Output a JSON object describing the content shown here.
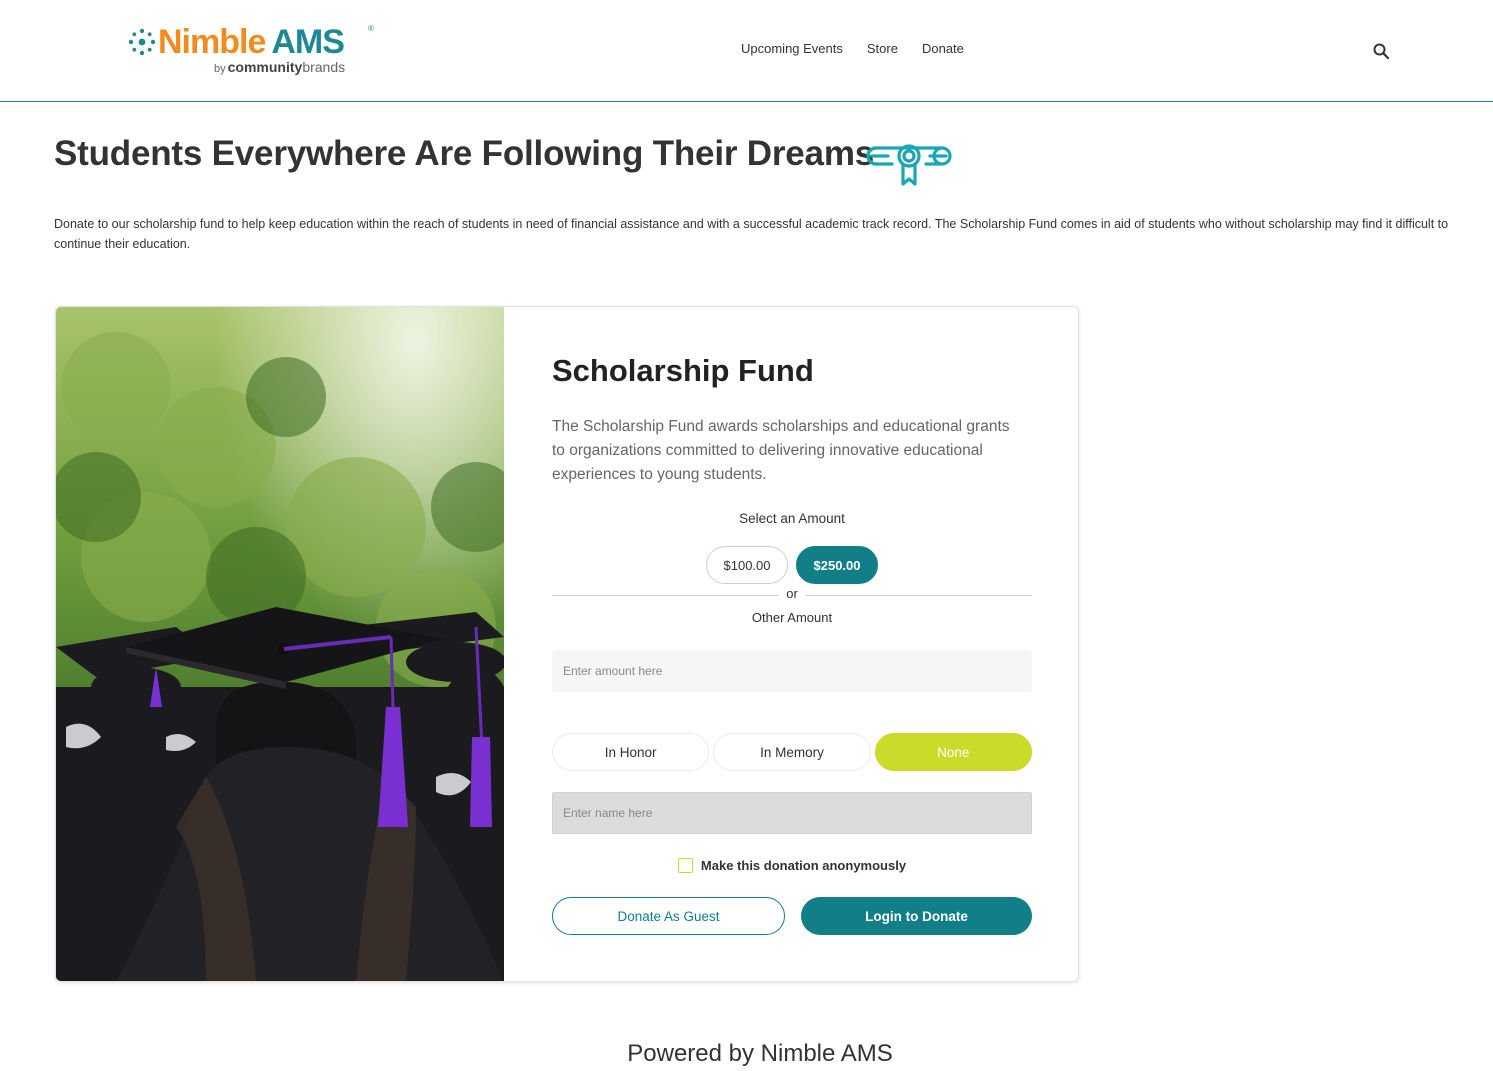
{
  "brand": {
    "name_part1": "Nimble",
    "name_part2": "AMS",
    "registered": "®",
    "by": "by",
    "company_bold": "community",
    "company_light": "brands",
    "colors": {
      "orange": "#f28c1e",
      "teal": "#1d8a93"
    }
  },
  "nav": {
    "items": [
      {
        "label": "Upcoming Events"
      },
      {
        "label": "Store"
      },
      {
        "label": "Donate"
      }
    ],
    "search_icon": "search-icon"
  },
  "page": {
    "title": "Students Everywhere Are Following Their Dreams",
    "title_icon": "diploma-icon",
    "intro": "Donate to our scholarship fund to help keep education within the reach of students in need of financial assistance and with a successful academic track record. The Scholarship Fund comes in aid of students who without scholarship may find it difficult to continue their education."
  },
  "fund": {
    "title": "Scholarship Fund",
    "description": "The Scholarship Fund awards scholarships and educational grants to organizations committed to delivering innovative educational experiences to young students.",
    "select_label": "Select an Amount",
    "amounts": [
      {
        "label": "$100.00",
        "selected": false
      },
      {
        "label": "$250.00",
        "selected": true
      }
    ],
    "or_text": "or",
    "other_label": "Other Amount",
    "amount_placeholder": "Enter amount here",
    "tribute_options": [
      {
        "label": "In Honor",
        "selected": false
      },
      {
        "label": "In Memory",
        "selected": false
      },
      {
        "label": "None",
        "selected": true
      }
    ],
    "name_placeholder": "Enter name here",
    "anonymous_label": "Make this donation anonymously",
    "anonymous_checked": false,
    "guest_button": "Donate As Guest",
    "login_button": "Login to Donate",
    "colors": {
      "primary": "#127e88",
      "accent": "#cbdb2a"
    }
  },
  "footer": {
    "text": "Powered by Nimble AMS"
  }
}
